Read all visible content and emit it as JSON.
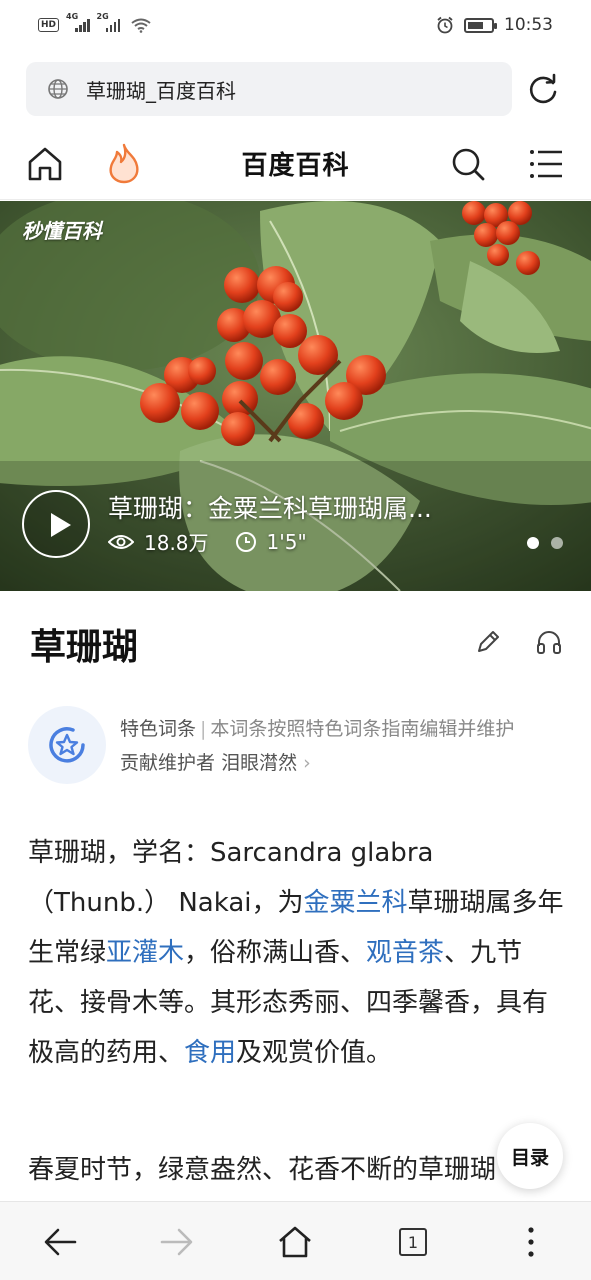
{
  "status_bar": {
    "left_badges": [
      "HD",
      "4G",
      "2G"
    ],
    "time": "10:53"
  },
  "url_bar": {
    "url_text": "草珊瑚_百度百科"
  },
  "header": {
    "title": "百度百科"
  },
  "hero": {
    "brand": "秒懂百科",
    "video_title": "草珊瑚：金粟兰科草珊瑚属...",
    "views": "18.8万",
    "duration": "1'5\"",
    "slides": 2,
    "active_slide": 1
  },
  "article": {
    "title": "草珊瑚",
    "featured_label": "特色词条",
    "featured_desc": "本词条按照特色词条指南编辑并维护",
    "maintainer_label": "贡献维护者",
    "maintainer_name": "泪眼潸然",
    "intro": {
      "t1": "草珊瑚，学名：Sarcandra glabra （Thunb.） Nakai，为",
      "link1": "金粟兰科",
      "t2": "草珊瑚属多年生常绿",
      "link2": "亚灌木",
      "t3": "，俗称满山香、",
      "link3": "观音茶",
      "t4": "、九节花、接骨木等。其形态秀丽、四季馨香，具有极高的药用、",
      "link4": "食用",
      "t5": "及观赏价值。"
    },
    "para2": "春夏时节，绿意盎然、花香不断的草珊瑚"
  },
  "toc_button": "目录",
  "bottom_bar": {
    "tab_count": "1"
  },
  "colors": {
    "link": "#2f6fbe",
    "fire": "#f07a3a",
    "featured_icon": "#4a7fe0"
  }
}
